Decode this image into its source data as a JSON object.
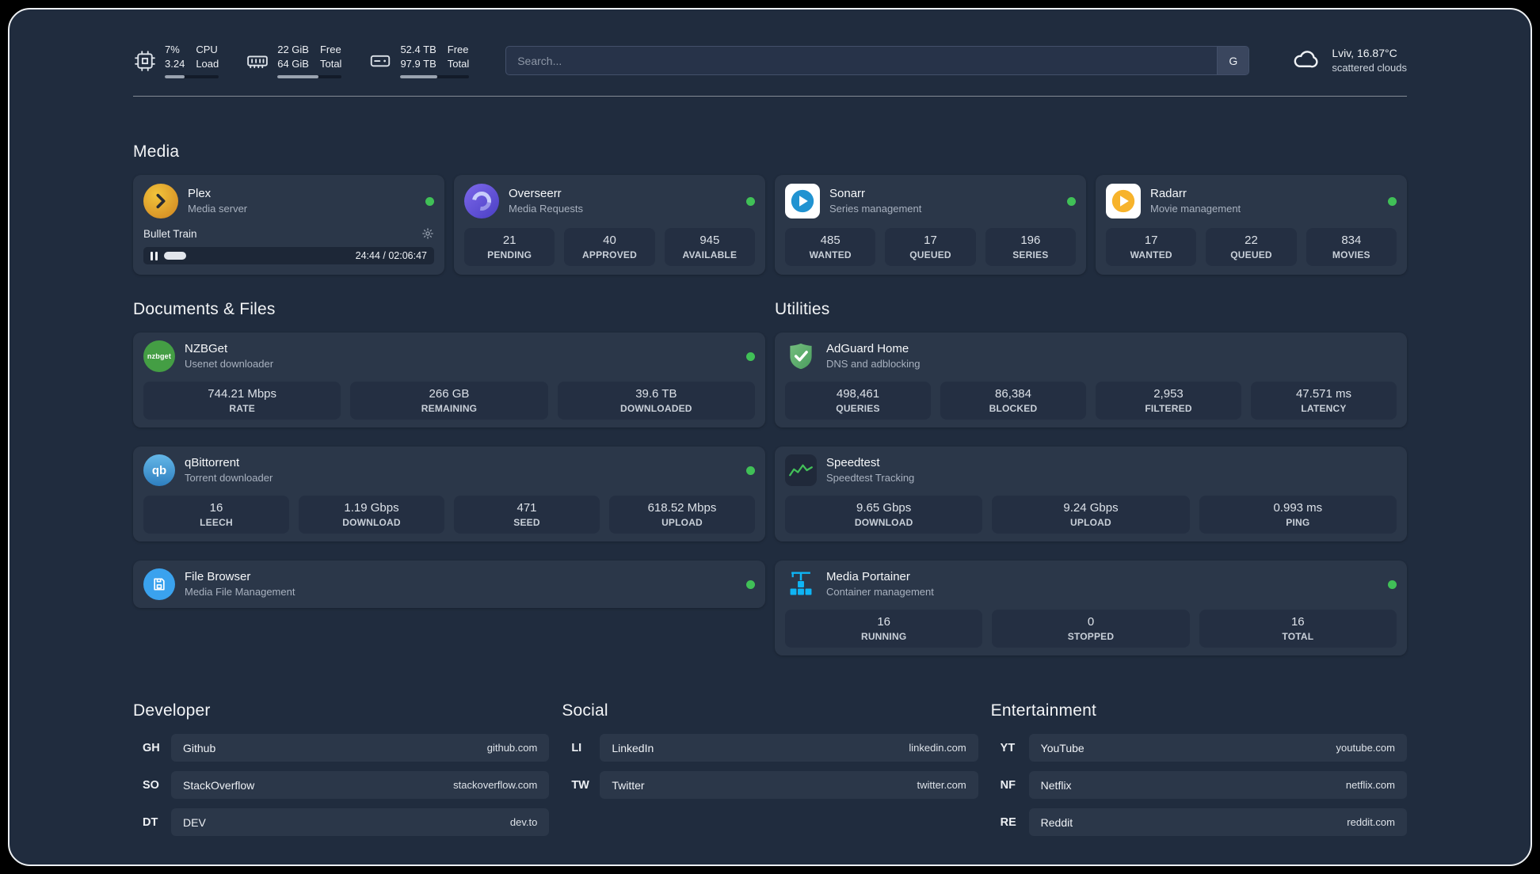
{
  "topbar": {
    "cpu": {
      "value_top": "7%",
      "value_bottom": "3.24",
      "caption_top": "CPU",
      "caption_bottom": "Load",
      "bar_percent": 36
    },
    "ram": {
      "value_top": "22 GiB",
      "value_bottom": "64 GiB",
      "caption_top": "Free",
      "caption_bottom": "Total",
      "bar_percent": 64
    },
    "disk": {
      "value_top": "52.4 TB",
      "value_bottom": "97.9 TB",
      "caption_top": "Free",
      "caption_bottom": "Total",
      "bar_percent": 54
    },
    "search": {
      "placeholder": "Search...",
      "engine_label": "G"
    },
    "weather": {
      "location": "Lviv, 16.87°C",
      "condition": "scattered clouds"
    }
  },
  "sections": {
    "media": {
      "title": "Media",
      "plex": {
        "name": "Plex",
        "description": "Media server",
        "player": {
          "title": "Bullet Train",
          "time": "24:44 / 02:06:47",
          "progress_percent": 12
        }
      },
      "overseerr": {
        "name": "Overseerr",
        "description": "Media Requests",
        "stats": [
          {
            "value": "21",
            "label": "PENDING"
          },
          {
            "value": "40",
            "label": "APPROVED"
          },
          {
            "value": "945",
            "label": "AVAILABLE"
          }
        ]
      },
      "sonarr": {
        "name": "Sonarr",
        "description": "Series management",
        "stats": [
          {
            "value": "485",
            "label": "WANTED"
          },
          {
            "value": "17",
            "label": "QUEUED"
          },
          {
            "value": "196",
            "label": "SERIES"
          }
        ]
      },
      "radarr": {
        "name": "Radarr",
        "description": "Movie management",
        "stats": [
          {
            "value": "17",
            "label": "WANTED"
          },
          {
            "value": "22",
            "label": "QUEUED"
          },
          {
            "value": "834",
            "label": "MOVIES"
          }
        ]
      }
    },
    "documents": {
      "title": "Documents & Files",
      "nzbget": {
        "name": "NZBGet",
        "description": "Usenet downloader",
        "icon_text": "nzbget",
        "stats": [
          {
            "value": "744.21 Mbps",
            "label": "RATE"
          },
          {
            "value": "266 GB",
            "label": "REMAINING"
          },
          {
            "value": "39.6 TB",
            "label": "DOWNLOADED"
          }
        ]
      },
      "qbittorrent": {
        "name": "qBittorrent",
        "description": "Torrent downloader",
        "icon_text": "qb",
        "stats": [
          {
            "value": "16",
            "label": "LEECH"
          },
          {
            "value": "1.19 Gbps",
            "label": "DOWNLOAD"
          },
          {
            "value": "471",
            "label": "SEED"
          },
          {
            "value": "618.52 Mbps",
            "label": "UPLOAD"
          }
        ]
      },
      "filebrowser": {
        "name": "File Browser",
        "description": "Media File Management"
      }
    },
    "utilities": {
      "title": "Utilities",
      "adguard": {
        "name": "AdGuard Home",
        "description": "DNS and adblocking",
        "stats": [
          {
            "value": "498,461",
            "label": "QUERIES"
          },
          {
            "value": "86,384",
            "label": "BLOCKED"
          },
          {
            "value": "2,953",
            "label": "FILTERED"
          },
          {
            "value": "47.571 ms",
            "label": "LATENCY"
          }
        ]
      },
      "speedtest": {
        "name": "Speedtest",
        "description": "Speedtest Tracking",
        "stats": [
          {
            "value": "9.65 Gbps",
            "label": "DOWNLOAD"
          },
          {
            "value": "9.24 Gbps",
            "label": "UPLOAD"
          },
          {
            "value": "0.993 ms",
            "label": "PING"
          }
        ]
      },
      "portainer": {
        "name": "Media Portainer",
        "description": "Container management",
        "stats": [
          {
            "value": "16",
            "label": "RUNNING"
          },
          {
            "value": "0",
            "label": "STOPPED"
          },
          {
            "value": "16",
            "label": "TOTAL"
          }
        ]
      }
    }
  },
  "bookmarks": {
    "developer": {
      "title": "Developer",
      "items": [
        {
          "abbr": "GH",
          "name": "Github",
          "url": "github.com"
        },
        {
          "abbr": "SO",
          "name": "StackOverflow",
          "url": "stackoverflow.com"
        },
        {
          "abbr": "DT",
          "name": "DEV",
          "url": "dev.to"
        }
      ]
    },
    "social": {
      "title": "Social",
      "items": [
        {
          "abbr": "LI",
          "name": "LinkedIn",
          "url": "linkedin.com"
        },
        {
          "abbr": "TW",
          "name": "Twitter",
          "url": "twitter.com"
        }
      ]
    },
    "entertainment": {
      "title": "Entertainment",
      "items": [
        {
          "abbr": "YT",
          "name": "YouTube",
          "url": "youtube.com"
        },
        {
          "abbr": "NF",
          "name": "Netflix",
          "url": "netflix.com"
        },
        {
          "abbr": "RE",
          "name": "Reddit",
          "url": "reddit.com"
        }
      ]
    }
  },
  "colors": {
    "status_online": "#40c057",
    "plex_accent": "#e8a33d",
    "overseerr_accent": "#6a5be2",
    "sonarr_accent": "#2193d1",
    "radarr_accent": "#f7b32b",
    "nzbget_accent": "#449e44",
    "qbittorrent_accent": "#4398d3",
    "filebrowser_accent": "#3aa2ee",
    "adguard_accent": "#5fae68",
    "speedtest_accent": "#43c059",
    "portainer_accent": "#0fb5f5"
  }
}
